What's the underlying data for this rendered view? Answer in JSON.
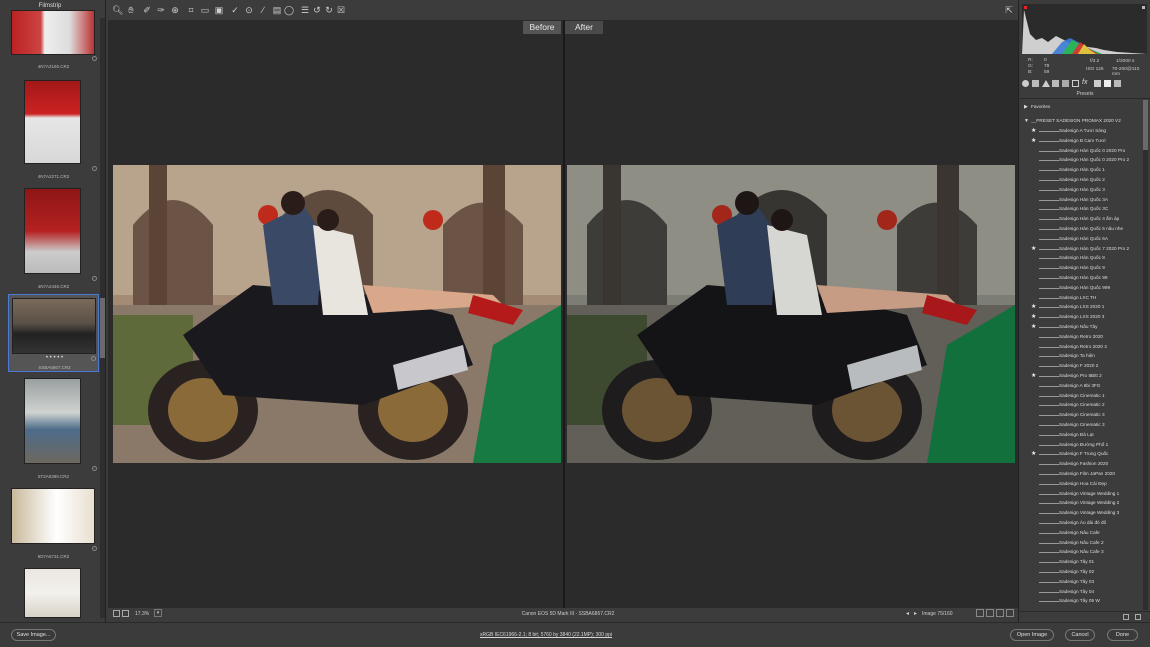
{
  "filmstrip": {
    "title": "Filmstrip",
    "thumbs": [
      {
        "caption": "4N7A2165.CR2"
      },
      {
        "caption": "4N7A2271.CR2"
      },
      {
        "caption": "4N7A2446.CR2"
      },
      {
        "caption": "SSBA6867.CR2",
        "rating": "• • • • •"
      },
      {
        "caption": "5T2A6399.CR2"
      },
      {
        "caption": "6D7A6731.CR2"
      },
      {
        "caption": ""
      }
    ]
  },
  "toolbar": {
    "icons": [
      "zoom-icon",
      "hand-icon",
      "white-balance-icon",
      "color-sampler-icon",
      "target-adjust-icon",
      "crop-icon",
      "straighten-icon",
      "transform-icon",
      "spot-removal-icon",
      "red-eye-icon",
      "adjustment-brush-icon",
      "graduated-filter-icon",
      "radial-filter-icon",
      "preferences-icon",
      "rotate-ccw-icon",
      "rotate-cw-icon",
      "trash-icon"
    ],
    "fullscreen_icon": "fullscreen-icon"
  },
  "compare": {
    "before": "Before",
    "after": "After"
  },
  "statusbar": {
    "zoom": "17.3%",
    "camera": "Canon EOS 5D Mark III  -  SSBA6867.CR2",
    "image_count": "Image 75/160"
  },
  "bottom": {
    "save_image": "Save Image...",
    "workflow": "sRGB IEC61966-2.1; 8 bit; 5760 by 3840 (22.1MP); 300 ppi",
    "open_image": "Open Image",
    "cancel": "Cancel",
    "done": "Done"
  },
  "readout": {
    "r_label": "R:",
    "g_label": "G:",
    "b_label": "B:",
    "r": "0",
    "g": "79",
    "b": "59",
    "aperture": "f/3.2",
    "shutter": "1/2000 s",
    "iso": "ISO 125",
    "lens": "70-200@110 mm"
  },
  "presets": {
    "header": "Presets",
    "favorites": "Favorites",
    "group": "__PRESET SADESIGN PROMAX 2020 V2",
    "items": [
      {
        "label": "Sadesign A Tươi Sáng",
        "star": true
      },
      {
        "label": "Sadesign B Cam Tươi",
        "star": true
      },
      {
        "label": "Sadesign Hàn Quốc 0 2020 Pro",
        "star": false
      },
      {
        "label": "Sadesign Hàn Quốc 0 2020 Pro 2",
        "star": false
      },
      {
        "label": "Sadesign Hàn Quốc 1",
        "star": false
      },
      {
        "label": "Sadesign Hàn Quốc 2",
        "star": false
      },
      {
        "label": "Sadesign Hàn Quốc 3",
        "star": false
      },
      {
        "label": "Sadesign Hàn Quốc 3A",
        "star": false
      },
      {
        "label": "Sadesign Hàn Quốc 3C",
        "star": false
      },
      {
        "label": "Sadesign Hàn Quốc 4 ấm áp",
        "star": false
      },
      {
        "label": "Sadesign Hàn Quốc 5 nâu nhe",
        "star": false
      },
      {
        "label": "Sadesign Hàn Quốc 6A",
        "star": false
      },
      {
        "label": "Sadesign Hàn Quốc 7 2020 Pro 2",
        "star": true
      },
      {
        "label": "Sadesign Hàn Quốc 8",
        "star": false
      },
      {
        "label": "Sadesign Hàn Quốc 9",
        "star": false
      },
      {
        "label": "Sadesign Hàn Quốc 99",
        "star": false
      },
      {
        "label": "Sadesign Hàn Quốc 999",
        "star": false
      },
      {
        "label": "Sadesign LXC  TH",
        "star": false
      },
      {
        "label": "Sadesign LXS 2020 1",
        "star": true
      },
      {
        "label": "Sadesign LXS 2020 3",
        "star": true
      },
      {
        "label": "Sadesign Nâu Tây",
        "star": true
      },
      {
        "label": "Sadesign Retro 2020",
        "star": false
      },
      {
        "label": "Sadesign Retro 2020 2",
        "star": false
      },
      {
        "label": "Sadesign Ta hiện",
        "star": false
      },
      {
        "label": "Sadesign  F 2020 2",
        "star": false
      },
      {
        "label": "Sadesign  Pro 8Bitt 2",
        "star": true
      },
      {
        "label": "Sadesign  A 8bi 3FG",
        "star": false
      },
      {
        "label": "Sadesign Cinematic 1",
        "star": false
      },
      {
        "label": "Sadesign Cinematic 2",
        "star": false
      },
      {
        "label": "Sadesign Cinematic 3",
        "star": false
      },
      {
        "label": "Sadesign Cinematic 3",
        "star": false
      },
      {
        "label": "Sadesign Đà Lạt",
        "star": false
      },
      {
        "label": "Sadesign Đường Phố 1",
        "star": false
      },
      {
        "label": "Sadesign F Trung Quốc",
        "star": true
      },
      {
        "label": "Sadesign Fashion 2020",
        "star": false
      },
      {
        "label": "Sadesign Film JaPan 2020",
        "star": false
      },
      {
        "label": "Sadesign Hoa Cải Đẹp",
        "star": false
      },
      {
        "label": "Sadesign Vintage Wedding 1",
        "star": false
      },
      {
        "label": "Sadesign Vintage Wedding 2",
        "star": false
      },
      {
        "label": "Sadesign Vintage Wedding 3",
        "star": false
      },
      {
        "label": "Sadesign Áo dài đỏ đô",
        "star": false
      },
      {
        "label": "Sadesign Nâu Cafe",
        "star": false
      },
      {
        "label": "Sadesign Nâu Cafe 2",
        "star": false
      },
      {
        "label": "Sadesign Nâu Cafe 3",
        "star": false
      },
      {
        "label": "Sadesign Tây 01",
        "star": false
      },
      {
        "label": "Sadesign Tây 02",
        "star": false
      },
      {
        "label": "Sadesign Tây 03",
        "star": false
      },
      {
        "label": "Sadesign Tây 04",
        "star": false
      },
      {
        "label": "Sadesign Tây 05 W",
        "star": false
      }
    ]
  }
}
